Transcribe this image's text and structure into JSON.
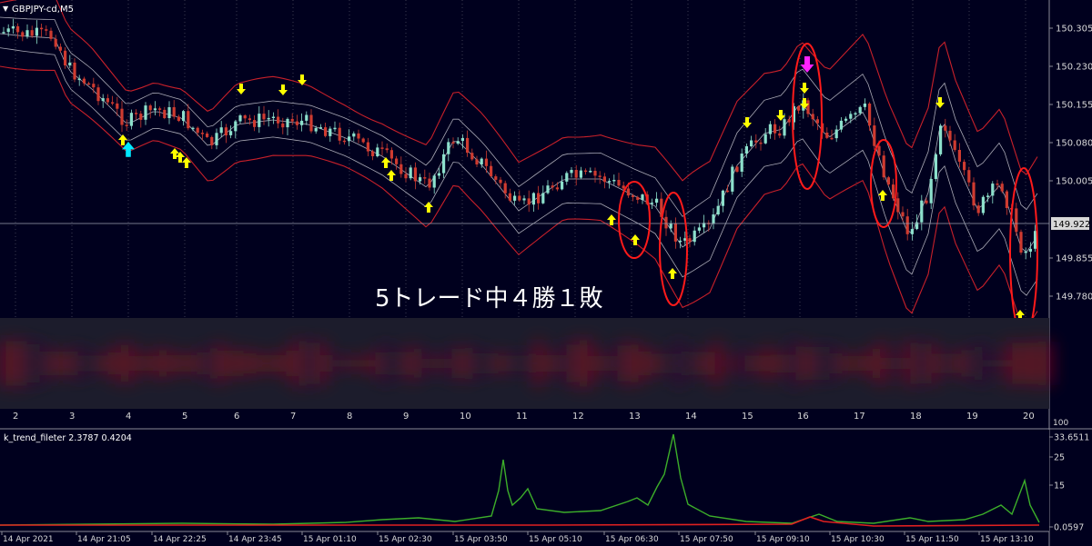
{
  "main_chart": {
    "symbol_label": "GBPJPY-cd,M5",
    "price_axis": {
      "ticks": [
        "150.305",
        "150.230",
        "150.155",
        "150.080",
        "150.005",
        "149.855",
        "149.780"
      ],
      "current_price": "149.922"
    },
    "annotation": "5トレード中４勝１敗",
    "blurred_indicator_note": "",
    "panel_axis_labels": [
      "2",
      "3",
      "4",
      "5",
      "6",
      "7",
      "8",
      "9",
      "10",
      "11",
      "12",
      "13",
      "14",
      "15",
      "16",
      "17",
      "18",
      "19",
      "20"
    ],
    "panel_axis_label_end": "100",
    "colors": {
      "background": "#00001e",
      "bull_candle": "#8de0cc",
      "bear_candle": "#cf3b30",
      "outer_band": "#c8202a",
      "inner_band": "#a9a9b5",
      "buy_arrow": "#ffff00",
      "sell_arrow": "#ffff00",
      "cyan_arrow": "#00e8ff",
      "magenta_arrow": "#ff22ff",
      "ellipse": "#ff1a1a"
    }
  },
  "indicator": {
    "label": "k_trend_fileter 2.3787 0.4204",
    "ticks": [
      "33.6511",
      "25",
      "15",
      "0.0597"
    ],
    "colors": {
      "green_line": "#3cae2a",
      "red_line": "#e02020"
    }
  },
  "time_axis": {
    "labels": [
      "14 Apr 2021",
      "14 Apr 21:05",
      "14 Apr 22:25",
      "14 Apr 23:45",
      "15 Apr 01:10",
      "15 Apr 02:30",
      "15 Apr 03:50",
      "15 Apr 05:10",
      "15 Apr 06:30",
      "15 Apr 07:50",
      "15 Apr 09:10",
      "15 Apr 10:30",
      "15 Apr 11:50",
      "15 Apr 13:10"
    ]
  }
}
